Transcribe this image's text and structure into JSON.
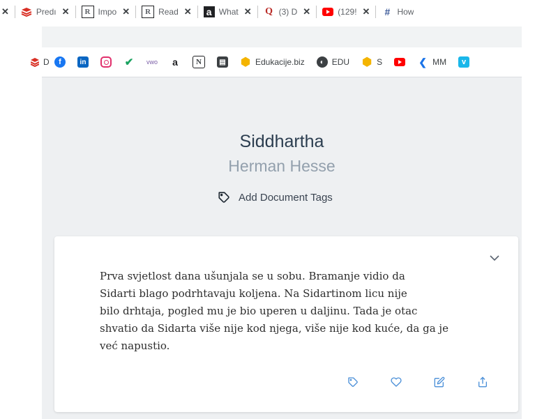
{
  "tabs": [
    {
      "title": "",
      "favicon": "",
      "color": "#5f6368"
    },
    {
      "title": "Predı",
      "favicon": "stack",
      "color": "#d93025"
    },
    {
      "title": "Impo",
      "favicon": "R",
      "color": "#202124"
    },
    {
      "title": "Read",
      "favicon": "R",
      "color": "#202124"
    },
    {
      "title": "What",
      "favicon": "a",
      "color": "#202124"
    },
    {
      "title": "(3) D",
      "favicon": "Q",
      "color": "#b92b27"
    },
    {
      "title": "(129!",
      "favicon": "yt",
      "color": "#ff0000"
    },
    {
      "title": "How",
      "favicon": "#",
      "color": "#3b5998"
    }
  ],
  "bookmarks": [
    {
      "label": "D",
      "icon": "stack",
      "color": "#d93025"
    },
    {
      "label": "",
      "icon": "f",
      "color": "#1877f2"
    },
    {
      "label": "",
      "icon": "in",
      "color": "#0a66c2"
    },
    {
      "label": "",
      "icon": "ig",
      "color": "#e1306c"
    },
    {
      "label": "",
      "icon": "check",
      "color": "#1aa260"
    },
    {
      "label": "",
      "icon": "vwo",
      "color": "#7b5ea7"
    },
    {
      "label": "",
      "icon": "a",
      "color": "#202124"
    },
    {
      "label": "",
      "icon": "N",
      "color": "#202124"
    },
    {
      "label": "",
      "icon": "save",
      "color": "#3c4043"
    },
    {
      "label": "Edukacije.biz",
      "icon": "hex",
      "color": "#f4b400"
    },
    {
      "label": "EDU",
      "icon": "globe",
      "color": "#3c4043"
    },
    {
      "label": "S",
      "icon": "hex",
      "color": "#f4b400"
    },
    {
      "label": "",
      "icon": "yt",
      "color": "#ff0000"
    },
    {
      "label": "MM",
      "icon": "mm",
      "color": "#1a73e8"
    },
    {
      "label": "",
      "icon": "v",
      "color": "#1ab7ea"
    }
  ],
  "book": {
    "title": "Siddhartha",
    "author": "Herman Hesse",
    "add_tags_label": "Add Document Tags"
  },
  "highlight": {
    "lines": [
      "Prva svjetlost dana ušunjala se u sobu. Bramanje vidio da",
      "Sidarti blago podrhtavaju koljena. Na Sidartinom licu nije",
      "bilo drhtaja, pogled mu je bio uperen u daljinu. Tada je otac",
      "shvatio da Sidarta više nije kod njega, više nije kod kuće, da ga je",
      "već napustio."
    ],
    "action_icons": [
      "tag-icon",
      "heart-icon",
      "edit-icon",
      "share-icon"
    ],
    "accent": "#4a8fd8"
  }
}
